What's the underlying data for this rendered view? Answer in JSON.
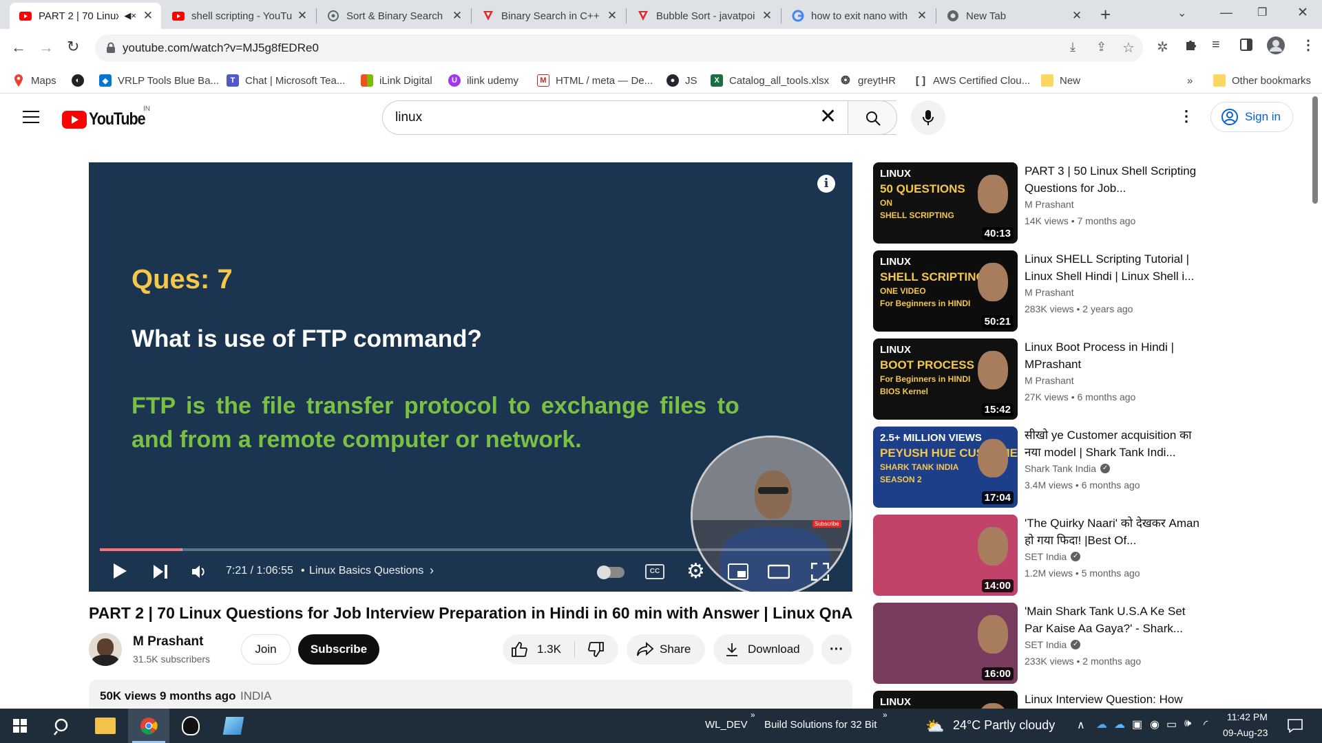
{
  "browser": {
    "tabs": [
      {
        "title": "PART 2 | 70 Linux",
        "favicon": "youtube-icon",
        "active": true,
        "muted_icon": "speaker-muted-icon"
      },
      {
        "title": "shell scripting - YouTu",
        "favicon": "youtube-icon"
      },
      {
        "title": "Sort & Binary Search",
        "favicon": "chatgpt-icon"
      },
      {
        "title": "Binary Search in C++",
        "favicon": "javatpoint-icon"
      },
      {
        "title": "Bubble Sort - javatpoi",
        "favicon": "javatpoint-icon"
      },
      {
        "title": "how to exit nano with",
        "favicon": "google-icon"
      },
      {
        "title": "New Tab",
        "favicon": "chrome-icon"
      }
    ],
    "url": "youtube.com/watch?v=MJ5g8fEDRe0",
    "bookmarks": [
      "Maps",
      "",
      "VRLP Tools Blue Ba...",
      "Chat | Microsoft Tea...",
      "iLink Digital",
      "ilink udemy",
      "HTML / meta — De...",
      "JS",
      "Catalog_all_tools.xlsx",
      "greytHR",
      "AWS Certified Clou...",
      "New"
    ],
    "other_bookmarks": "Other bookmarks",
    "more_bookmarks": "»"
  },
  "youtube": {
    "logo_text": "YouTube",
    "region": "IN",
    "search_value": "linux",
    "sign_in": "Sign in",
    "player": {
      "question_label": "Ques: 7",
      "question": "What is use of FTP command?",
      "answer_line1": "FTP is the file transfer protocol to exchange files to",
      "answer_line2": "and from a remote computer or network.",
      "time": "7:21 / 1:06:55",
      "chapter": "Linux Basics Questions",
      "progress": 0.11,
      "subscribe_badge": "Subscribe"
    },
    "video": {
      "title": "PART 2 | 70 Linux Questions for Job Interview Preparation in Hindi in 60 min with Answer | Linux QnA",
      "channel": "M Prashant",
      "subscribers": "31.5K subscribers",
      "join": "Join",
      "subscribe": "Subscribe",
      "likes": "1.3K",
      "share": "Share",
      "download": "Download",
      "views": "50K views",
      "age": "9 months ago",
      "location": "INDIA"
    },
    "recommendations": [
      {
        "title": "PART 3 | 50 Linux Shell Scripting Questions for Job...",
        "channel": "M Prashant",
        "verified": false,
        "views": "14K views",
        "age": "7 months ago",
        "duration": "40:13",
        "thumb_lines": [
          "LINUX",
          "50 QUESTIONS",
          "ON",
          "SHELL SCRIPTING"
        ],
        "thumb_bg": "#111111"
      },
      {
        "title": "Linux SHELL Scripting Tutorial | Linux Shell Hindi | Linux Shell i...",
        "channel": "M Prashant",
        "verified": false,
        "views": "283K views",
        "age": "2 years ago",
        "duration": "50:21",
        "thumb_lines": [
          "LINUX",
          "SHELL SCRIPTING IN",
          "ONE VIDEO",
          "For Beginners in HINDI"
        ],
        "thumb_bg": "#0d0d0d"
      },
      {
        "title": "Linux Boot Process in Hindi | MPrashant",
        "channel": "M Prashant",
        "verified": false,
        "views": "27K views",
        "age": "6 months ago",
        "duration": "15:42",
        "thumb_lines": [
          "LINUX",
          "BOOT PROCESS",
          "For Beginners in HINDI",
          "BIOS  Kernel"
        ],
        "thumb_bg": "#101010"
      },
      {
        "title": "सीखो ye Customer acquisition का नया model | Shark Tank Indi...",
        "channel": "Shark Tank India",
        "verified": true,
        "views": "3.4M views",
        "age": "6 months ago",
        "duration": "17:04",
        "thumb_lines": [
          "2.5+ MILLION VIEWS",
          "PEYUSH HUE CUSTOMER ACQUISITION MODEL SE IMPRESS",
          "SHARK TANK INDIA",
          "SEASON 2"
        ],
        "thumb_bg": "#1d3f8a"
      },
      {
        "title": "'The Quirky Naari' को देखकर Aman हो गया फिदा! |Best Of...",
        "channel": "SET India",
        "verified": true,
        "views": "1.2M views",
        "age": "5 months ago",
        "duration": "14:00",
        "thumb_lines": [],
        "thumb_bg": "#c1436a"
      },
      {
        "title": "'Main Shark Tank U.S.A Ke Set Par Kaise Aa Gaya?' - Shark...",
        "channel": "SET India",
        "verified": true,
        "views": "233K views",
        "age": "2 months ago",
        "duration": "16:00",
        "thumb_lines": [],
        "thumb_bg": "#7a3c5e"
      },
      {
        "title": "Linux Interview Question: How",
        "channel": "",
        "verified": false,
        "views": "",
        "age": "",
        "duration": "",
        "thumb_lines": [
          "LINUX"
        ],
        "thumb_bg": "#111111"
      }
    ]
  },
  "taskbar": {
    "items": [
      "WL_DEV",
      "Build Solutions for 32 Bit"
    ],
    "weather": "24°C  Partly cloudy",
    "time": "11:42 PM",
    "date": "09-Aug-23"
  },
  "colors": {
    "yt_red": "#ff0000",
    "answer_green": "#7ac143",
    "question_yellow": "#f5c84c",
    "player_bg": "#1b3550",
    "link_blue": "#065fd4"
  }
}
